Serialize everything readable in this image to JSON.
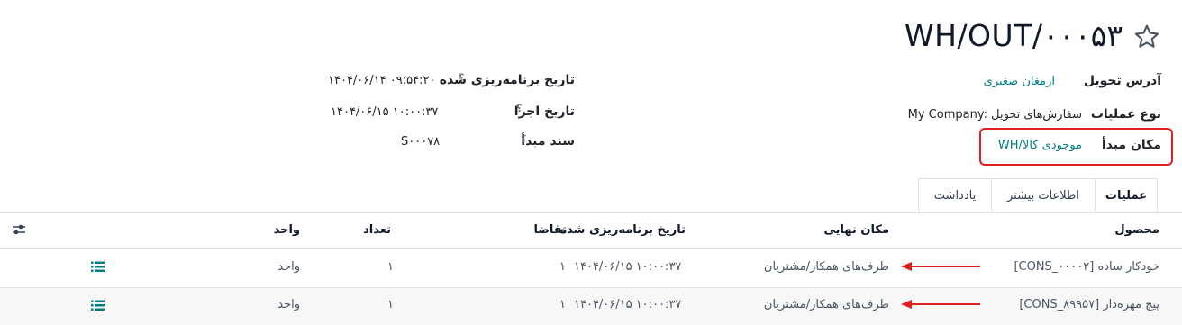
{
  "record": {
    "title": "WH/OUT/۰۰۰۵۳"
  },
  "fields_right": [
    {
      "label": "آدرس تحویل",
      "value": "ارمغان صغیری"
    },
    {
      "label": "نوع عملیات",
      "value": "My Company: سفارش‌های تحویل"
    },
    {
      "label": "مکان مبدأ",
      "value": "WH/موجودی کالا"
    }
  ],
  "fields_left": [
    {
      "label": "تاریخ برنامه‌ریزی شده",
      "help": "؟",
      "value": "۱۴۰۴/۰۶/۱۴ ۰۹:۵۴:۲۰"
    },
    {
      "label": "تاریخ اجرا",
      "help": "؟",
      "value": "۱۴۰۴/۰۶/۱۵ ۱۰:۰۰:۳۷"
    },
    {
      "label": "سند مبدأ",
      "help": "؟",
      "value": "S۰۰۰۷۸"
    }
  ],
  "tabs": [
    {
      "label": "عملیات",
      "active": true
    },
    {
      "label": "اطلاعات بیشتر",
      "active": false
    },
    {
      "label": "یادداشت",
      "active": false
    }
  ],
  "table": {
    "headers": {
      "product": "محصول",
      "final_location": "مکان نهایی",
      "scheduled_date": "تاریخ برنامه‌ریزی شده",
      "demand": "تقاضا",
      "quantity": "تعداد",
      "unit": "واحد"
    },
    "rows": [
      {
        "product": "[CONS_۰۰۰۰۲] خودکار ساده",
        "final_location": "طرف‌های همکار/مشتریان",
        "scheduled_date": "۱۴۰۴/۰۶/۱۵ ۱۰:۰۰:۳۷",
        "demand": "۱",
        "quantity": "۱",
        "unit": "واحد"
      },
      {
        "product": "[CONS_۸۹۹۵۷] پیچ مهره‌دار",
        "final_location": "طرف‌های همکار/مشتریان",
        "scheduled_date": "۱۴۰۴/۰۶/۱۵ ۱۰:۰۰:۳۷",
        "demand": "۱",
        "quantity": "۱",
        "unit": "واحد"
      }
    ]
  },
  "colors": {
    "link": "#017e84",
    "highlight": "#e02020",
    "annotation_arrow": "#e02020"
  },
  "icons": {
    "favorite": "star-outline-icon",
    "row_detail": "list-icon",
    "optional_columns": "sliders-icon"
  }
}
